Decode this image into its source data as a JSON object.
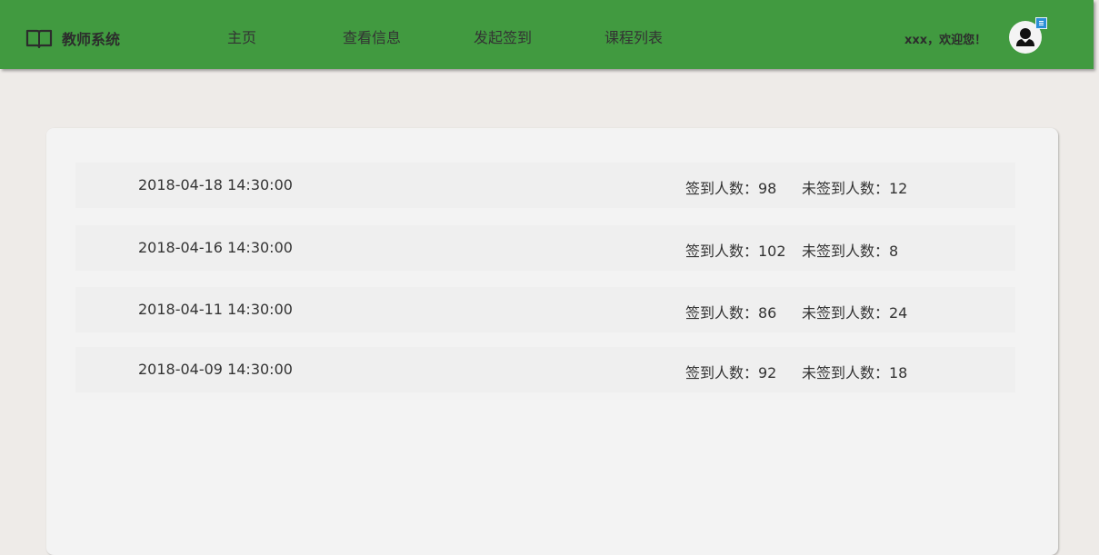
{
  "header": {
    "brand_title": "教师系统",
    "nav": [
      {
        "label": "主页"
      },
      {
        "label": "查看信息"
      },
      {
        "label": "发起签到"
      },
      {
        "label": "课程列表"
      }
    ],
    "welcome_text": "xxx，欢迎您！",
    "colors": {
      "topbar": "#419a40",
      "badge": "#2a8fd6"
    }
  },
  "records": [
    {
      "datetime": "2018-04-18 14:30:00",
      "signed_label": "签到人数：98",
      "unsigned_label": "未签到人数：12"
    },
    {
      "datetime": "2018-04-16 14:30:00",
      "signed_label": "签到人数：102",
      "unsigned_label": "未签到人数：8"
    },
    {
      "datetime": "2018-04-11 14:30:00",
      "signed_label": "签到人数：86",
      "unsigned_label": "未签到人数：24"
    },
    {
      "datetime": "2018-04-09 14:30:00",
      "signed_label": "签到人数：92",
      "unsigned_label": "未签到人数：18"
    }
  ],
  "icons": {
    "brand": "open-book-icon",
    "avatar": "user-icon",
    "badge": "menu-icon"
  }
}
